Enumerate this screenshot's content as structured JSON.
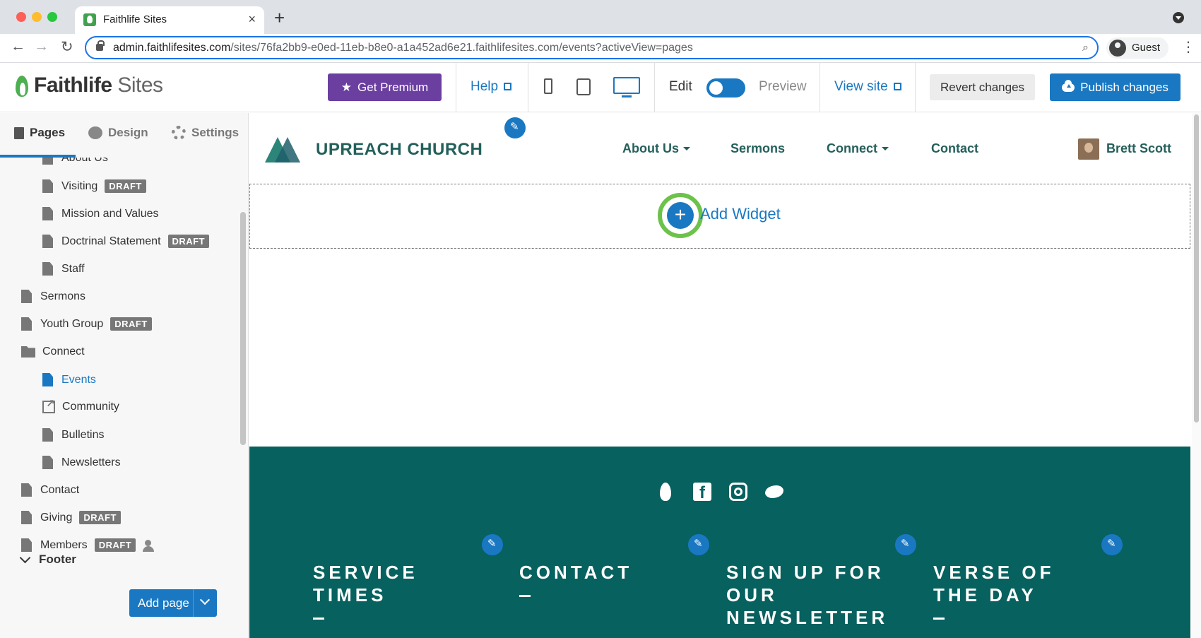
{
  "browser": {
    "tab_title": "Faithlife Sites",
    "tab_close": "×",
    "new_tab": "+",
    "url_host": "admin.faithlifesites.com",
    "url_path": "/sites/76fa2bb9-e0ed-11eb-b8e0-a1a452ad6e21.faithlifesites.com/events?activeView=pages",
    "profile_label": "Guest",
    "back": "←",
    "forward": "→",
    "reload": "↻",
    "zoom": "⌕",
    "menu": "⋮"
  },
  "app_header": {
    "logo_part1": "Faithlife",
    "logo_part2": " Sites",
    "premium_label": "Get Premium",
    "help_label": "Help",
    "edit_label": "Edit",
    "preview_label": "Preview",
    "view_site_label": "View site",
    "revert_label": "Revert changes",
    "publish_label": "Publish changes"
  },
  "sidebar": {
    "tabs": [
      {
        "label": "Pages"
      },
      {
        "label": "Design"
      },
      {
        "label": "Settings"
      }
    ],
    "items": [
      {
        "label": "About Us"
      },
      {
        "label": "Visiting",
        "badge": "DRAFT"
      },
      {
        "label": "Mission and Values"
      },
      {
        "label": "Doctrinal Statement",
        "badge": "DRAFT"
      },
      {
        "label": "Staff"
      },
      {
        "label": "Sermons"
      },
      {
        "label": "Youth Group",
        "badge": "DRAFT"
      },
      {
        "label": "Connect"
      },
      {
        "label": "Events"
      },
      {
        "label": "Community"
      },
      {
        "label": "Bulletins"
      },
      {
        "label": "Newsletters"
      },
      {
        "label": "Contact"
      },
      {
        "label": "Giving",
        "badge": "DRAFT"
      },
      {
        "label": "Members",
        "badge": "DRAFT"
      }
    ],
    "footer_label": "Footer",
    "add_page_label": "Add page"
  },
  "site": {
    "name": "UPREACH CHURCH",
    "nav": [
      {
        "label": "About Us"
      },
      {
        "label": "Sermons"
      },
      {
        "label": "Connect"
      },
      {
        "label": "Contact"
      }
    ],
    "user_name": "Brett Scott",
    "add_widget_label": "Add Widget",
    "add_symbol": "+",
    "footer_columns": [
      {
        "title": "Service Times"
      },
      {
        "title": "Contact"
      },
      {
        "title": "Sign up for our newsletter"
      },
      {
        "title": "Verse of the day"
      }
    ]
  },
  "colors": {
    "accent": "#1a78c2",
    "premium": "#6b3fa0",
    "site_teal": "#24605b",
    "footer_bg": "#07615f",
    "highlight_ring": "#6cc24a"
  }
}
